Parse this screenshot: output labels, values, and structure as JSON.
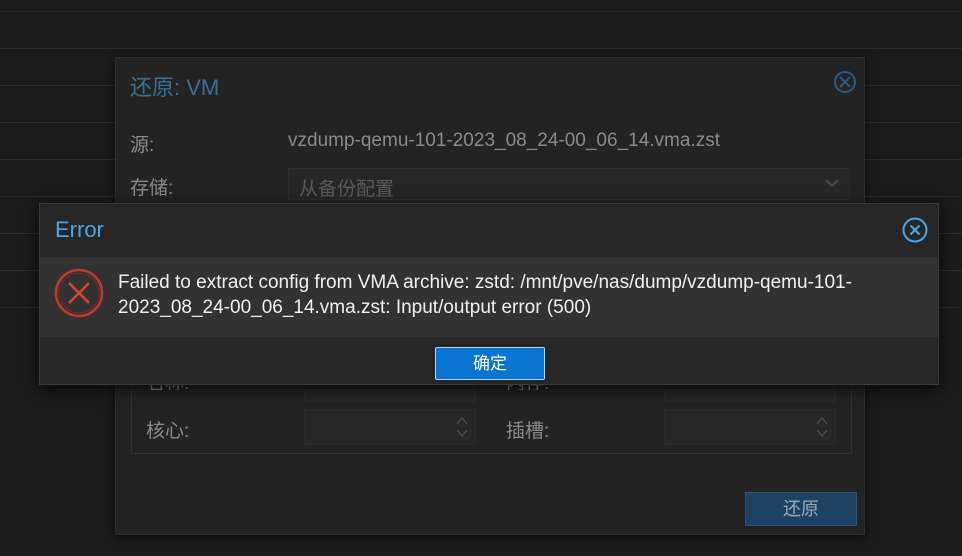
{
  "restore_dialog": {
    "title": "还原: VM",
    "source_label": "源:",
    "source_value": "vzdump-qemu-101-2023_08_24-00_06_14.vma.zst",
    "storage_label": "存储:",
    "storage_value": "从备份配置",
    "name_label_partial": "名称:",
    "memory_label_partial": "内存:",
    "cores_label": "核心:",
    "sockets_label": "插槽:",
    "restore_button": "还原"
  },
  "error_dialog": {
    "title": "Error",
    "message": "Failed to extract config from VMA archive: zstd: /mnt/pve/nas/dump/vzdump-qemu-101-2023_08_24-00_06_14.vma.zst: Input/output error (500)",
    "ok_button": "确定"
  },
  "icons": {
    "error_icon": "error-circle-x-icon",
    "close_icon": "close-circle-icon",
    "dropdown_icon": "chevron-down-icon",
    "spinner_icon": "spinner-arrows-icon"
  },
  "colors": {
    "accent_blue": "#4aa6e8",
    "button_blue": "#0a74d2",
    "error_red": "#c0392b"
  }
}
